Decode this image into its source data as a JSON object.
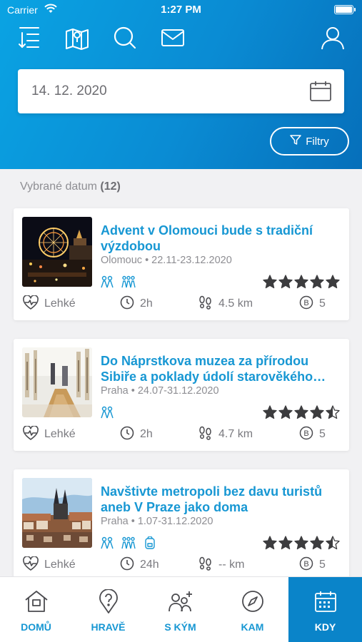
{
  "status_bar": {
    "carrier": "Carrier",
    "time": "1:27 PM"
  },
  "top_nav": {
    "icons": [
      "sort-list-icon",
      "map-icon",
      "search-icon",
      "mail-icon",
      "user-profile-icon"
    ]
  },
  "date_field": {
    "value": "14. 12. 2020",
    "icon": "calendar-icon"
  },
  "filter_button": {
    "label": "Filtry",
    "icon": "funnel-icon"
  },
  "section": {
    "label": "Vybrané datum",
    "count": "(12)"
  },
  "events": [
    {
      "title": "Advent v Olomouci bude s tradiční výzdobou",
      "place": "Olomouc",
      "dates": "22.11-23.12.2020",
      "groups": [
        "couple-icon",
        "family-icon"
      ],
      "rating": 5,
      "difficulty": "Lehké",
      "duration": "2h",
      "distance": "4.5 km",
      "price": "5"
    },
    {
      "title": "Do Náprstkova muzea za přírodou Sibiře a poklady údolí starověkého…",
      "place": "Praha",
      "dates": "24.07-31.12.2020",
      "groups": [
        "couple-icon"
      ],
      "rating": 4.5,
      "difficulty": "Lehké",
      "duration": "2h",
      "distance": "4.7 km",
      "price": "5"
    },
    {
      "title": "Navštivte metropoli bez davu turistů aneb V Praze jako doma",
      "place": "Praha",
      "dates": "1.07-31.12.2020",
      "groups": [
        "couple-icon",
        "family-icon",
        "backpack-icon"
      ],
      "rating": 4.5,
      "difficulty": "Lehké",
      "duration": "24h",
      "distance": "-- km",
      "price": "5"
    }
  ],
  "tabs": [
    {
      "label": "DOMŮ",
      "icon": "home-icon"
    },
    {
      "label": "HRAVĚ",
      "icon": "question-pin-icon"
    },
    {
      "label": "S KÝM",
      "icon": "people-add-icon"
    },
    {
      "label": "KAM",
      "icon": "compass-icon"
    },
    {
      "label": "KDY",
      "icon": "calendar-icon",
      "active": true
    }
  ],
  "colors": {
    "accent": "#1797d3",
    "header_start": "#0aa3e3",
    "header_end": "#066fba",
    "active_tab": "#0a84c9",
    "star": "#3c3c3e"
  }
}
